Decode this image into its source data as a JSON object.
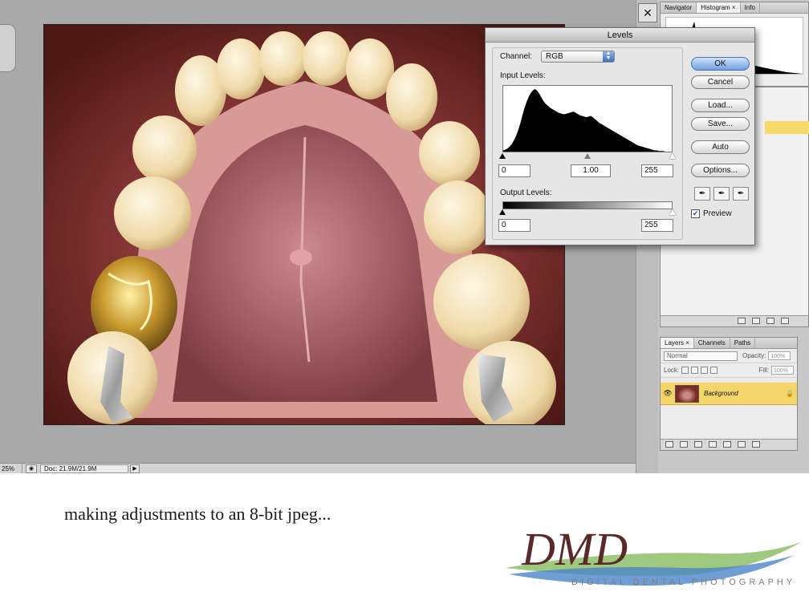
{
  "status_bar": {
    "zoom": "25%",
    "doc_info": "Doc: 21.9M/21.9M"
  },
  "panels": {
    "histogram_group": {
      "tabs": [
        "Navigator",
        "Histogram ×",
        "Info"
      ]
    },
    "layers": {
      "tabs": [
        "Layers ×",
        "Channels",
        "Paths"
      ],
      "blend_mode": "Normal",
      "opacity_label": "Opacity:",
      "opacity_value": "100%",
      "lock_label": "Lock:",
      "fill_label": "Fill:",
      "fill_value": "100%",
      "layer_name": "Background"
    }
  },
  "levels_dialog": {
    "title": "Levels",
    "channel_label": "Channel:",
    "channel_value": "RGB",
    "input_levels_label": "Input Levels:",
    "input_black": "0",
    "input_gamma": "1.00",
    "input_white": "255",
    "output_levels_label": "Output Levels:",
    "output_black": "0",
    "output_white": "255",
    "buttons": {
      "ok": "OK",
      "cancel": "Cancel",
      "load": "Load...",
      "save": "Save...",
      "auto": "Auto",
      "options": "Options..."
    },
    "preview_label": "Preview",
    "preview_checked": true,
    "histogram": [
      2,
      3,
      5,
      8,
      12,
      18,
      25,
      34,
      45,
      58,
      70,
      80,
      88,
      94,
      98,
      100,
      97,
      92,
      86,
      80,
      76,
      73,
      70,
      68,
      66,
      64,
      62,
      61,
      60,
      60,
      61,
      62,
      63,
      64,
      62,
      60,
      58,
      57,
      56,
      55,
      56,
      57,
      55,
      52,
      49,
      46,
      44,
      42,
      40,
      38,
      36,
      34,
      32,
      30,
      28,
      26,
      24,
      22,
      20,
      18,
      16,
      14,
      12,
      10,
      9,
      8,
      7,
      6,
      5,
      4,
      3,
      2,
      2,
      1,
      1,
      1,
      0,
      0,
      0,
      0
    ]
  },
  "caption": "making adjustments to an 8-bit jpeg...",
  "logo": {
    "monogram": "DMD",
    "tagline": "DIGITAL DENTAL PHOTOGRAPHY",
    "colors": {
      "script": "#5a2a2a",
      "swash_green": "#8fbf6a",
      "swash_blue": "#4a86c8"
    }
  }
}
